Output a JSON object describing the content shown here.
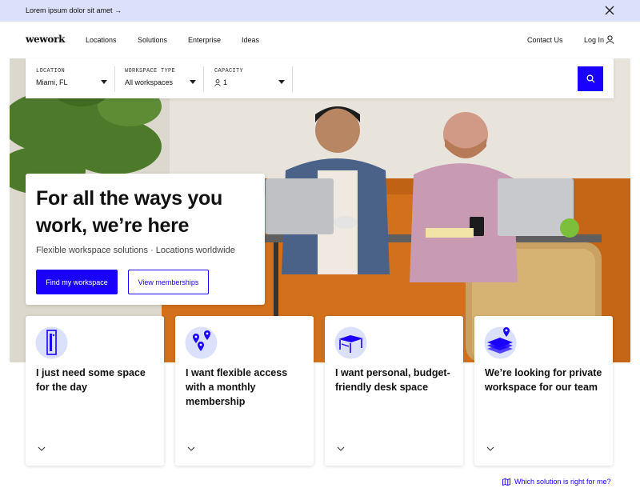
{
  "banner": {
    "text": "Lorem ipsum dolor sit amet →"
  },
  "nav": {
    "logo": "wework",
    "items": [
      "Locations",
      "Solutions",
      "Enterprise",
      "Ideas"
    ],
    "contact": "Contact Us",
    "login": "Log In"
  },
  "search": {
    "location": {
      "label": "LOCATION",
      "value": "Miami, FL"
    },
    "workspace_type": {
      "label": "WORKSPACE TYPE",
      "value": "All workspaces"
    },
    "capacity": {
      "label": "CAPACITY",
      "value": "1"
    }
  },
  "hero": {
    "title": "For all the ways you work, we’re here",
    "subtitle": "Flexible workspace solutions · Locations worldwide",
    "primary_button": "Find my workspace",
    "secondary_button": "View memberships"
  },
  "options": [
    {
      "text": "I just need some space for the day",
      "icon": "day-pass-icon"
    },
    {
      "text": "I want flexible access with a monthly membership",
      "icon": "map-pins-icon"
    },
    {
      "text": "I want personal, budget-friendly desk space",
      "icon": "desk-icon"
    },
    {
      "text": "We’re looking for private workspace for our team",
      "icon": "office-building-icon"
    }
  ],
  "help_link": "Which solution is right for me?",
  "colors": {
    "brand": "#1a00ff",
    "banner": "#dbe0fb",
    "icon_bg": "#dbe0fb"
  }
}
